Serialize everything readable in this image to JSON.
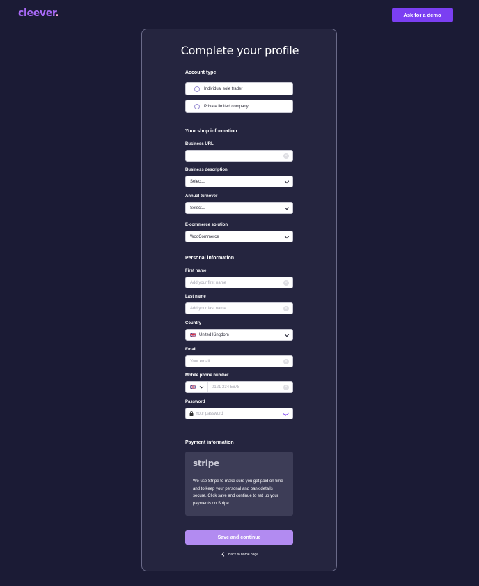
{
  "header": {
    "logo_text": "cleever",
    "logo_dot": ".",
    "demo_button": "Ask for a demo"
  },
  "form": {
    "title": "Complete your profile",
    "account_type": {
      "heading": "Account type",
      "options": [
        "Individual sole trader",
        "Private limited company"
      ]
    },
    "shop": {
      "heading": "Your shop information",
      "business_url_label": "Business URL",
      "business_url_value": "",
      "business_description_label": "Business description",
      "business_description_value": "Select...",
      "annual_turnover_label": "Annual turnover",
      "annual_turnover_value": "Select...",
      "ecommerce_label": "E-commerce solution",
      "ecommerce_value": "WooCommerce"
    },
    "personal": {
      "heading": "Personal information",
      "first_name_label": "First name",
      "first_name_placeholder": "Add your first name",
      "last_name_label": "Last name",
      "last_name_placeholder": "Add your last name",
      "country_label": "Country",
      "country_value": "United Kingdom",
      "email_label": "Email",
      "email_placeholder": "Your email",
      "phone_label": "Mobile phone number",
      "phone_placeholder": "0121 234 5678",
      "password_label": "Password",
      "password_placeholder": "Your password"
    },
    "payment": {
      "heading": "Payment information",
      "provider_logo": "stripe",
      "description": "We use Stripe to make sure you get paid on time and to keep your personal and bank details secure. Click save and continue to set up your payments on Stripe."
    },
    "save_button": "Save and continue",
    "back_link": "Back to home page"
  },
  "colors": {
    "background": "#1b1b35",
    "card": "#25253f",
    "accent": "#7b3ff2",
    "save_button": "#b28bf1"
  }
}
